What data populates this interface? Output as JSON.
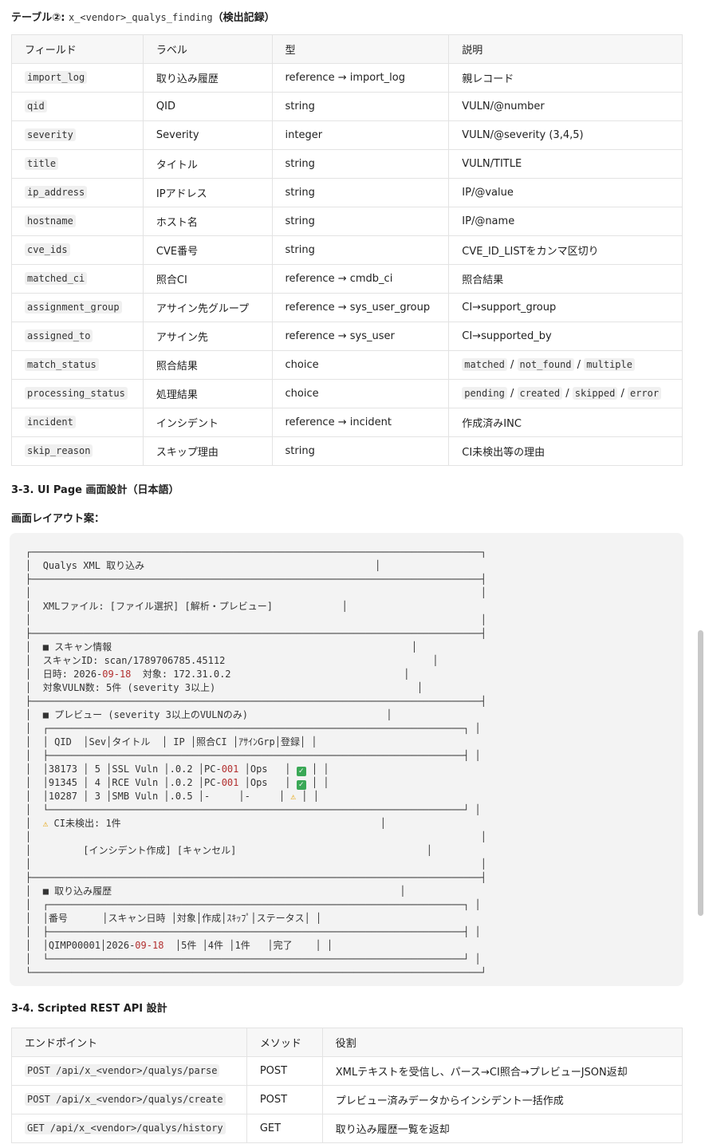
{
  "table2": {
    "title_prefix": "テーブル②: ",
    "table_name": "x_<vendor>_qualys_finding",
    "title_suffix": "（検出記録）",
    "headers": [
      "フィールド",
      "ラベル",
      "型",
      "説明"
    ],
    "rows": [
      {
        "field": "import_log",
        "label": "取り込み履歴",
        "type": "reference → import_log",
        "desc": "親レコード"
      },
      {
        "field": "qid",
        "label": "QID",
        "type": "string",
        "desc": "VULN/@number"
      },
      {
        "field": "severity",
        "label": "Severity",
        "type": "integer",
        "desc": "VULN/@severity (3,4,5)"
      },
      {
        "field": "title",
        "label": "タイトル",
        "type": "string",
        "desc": "VULN/TITLE"
      },
      {
        "field": "ip_address",
        "label": "IPアドレス",
        "type": "string",
        "desc": "IP/@value"
      },
      {
        "field": "hostname",
        "label": "ホスト名",
        "type": "string",
        "desc": "IP/@name"
      },
      {
        "field": "cve_ids",
        "label": "CVE番号",
        "type": "string",
        "desc": "CVE_ID_LISTをカンマ区切り"
      },
      {
        "field": "matched_ci",
        "label": "照合CI",
        "type": "reference → cmdb_ci",
        "desc": "照合結果"
      },
      {
        "field": "assignment_group",
        "label": "アサイン先グループ",
        "type": "reference → sys_user_group",
        "desc": "CI→support_group"
      },
      {
        "field": "assigned_to",
        "label": "アサイン先",
        "type": "reference → sys_user",
        "desc": "CI→supported_by"
      },
      {
        "field": "match_status",
        "label": "照合結果",
        "type": "choice",
        "desc_codes": [
          "matched",
          "not_found",
          "multiple"
        ]
      },
      {
        "field": "processing_status",
        "label": "処理結果",
        "type": "choice",
        "desc_codes": [
          "pending",
          "created",
          "skipped",
          "error"
        ]
      },
      {
        "field": "incident",
        "label": "インシデント",
        "type": "reference → incident",
        "desc": "作成済みINC"
      },
      {
        "field": "skip_reason",
        "label": "スキップ理由",
        "type": "string",
        "desc": "CI未検出等の理由"
      }
    ]
  },
  "section_3_3": {
    "title": "3-3. UI Page 画面設計（日本語）",
    "layout_title": "画面レイアウト案："
  },
  "mockup": {
    "app_title": "Qualys XML 取り込み",
    "xml_line": "XMLファイル: [ファイル選択] [解析・プレビュー]",
    "scan_info_title": "■ スキャン情報",
    "scan_id": "スキャンID: scan/1789706785.45112",
    "datetime_label": "日時: ",
    "datetime_y": "2026-",
    "datetime_md": "09-18",
    "target": "  対象: 172.31.0.2",
    "vuln_count": "対象VULN数: 5件 (severity 3以上)",
    "preview_title": "■ プレビュー (severity 3以上のVULNのみ)",
    "preview_rows": [
      {
        "qid": "38173",
        "sev": "5",
        "title": "SSL Vuln",
        "ip": ".0.2",
        "ci_pre": "PC-",
        "ci_num": "001",
        "grp": "Ops",
        "status": "ok"
      },
      {
        "qid": "91345",
        "sev": "4",
        "title": "RCE Vuln",
        "ip": ".0.2",
        "ci_pre": "PC-",
        "ci_num": "001",
        "grp": "Ops",
        "status": "ok"
      },
      {
        "qid": "10287",
        "sev": "3",
        "title": "SMB Vuln",
        "ip": ".0.5",
        "ci_pre": "",
        "ci_num": "-",
        "grp": "-",
        "status": "warn"
      }
    ],
    "ci_not_found": "CI未検出: 1件",
    "buttons": "[インシデント作成] [キャンセル]",
    "history_title": "■ 取り込み履歴",
    "history_row": {
      "no": "QIMP00001",
      "dt_y": "2026-",
      "dt_md": "09-18",
      "targets": "5件",
      "created": "4件",
      "skipped": "1件",
      "status": "完了"
    }
  },
  "section_3_4": {
    "title": "3-4. Scripted REST API 設計",
    "headers": [
      "エンドポイント",
      "メソッド",
      "役割"
    ],
    "rows": [
      {
        "endpoint": "POST /api/x_<vendor>/qualys/parse",
        "method": "POST",
        "role": "XMLテキストを受信し、パース→CI照合→プレビューJSON返却"
      },
      {
        "endpoint": "POST /api/x_<vendor>/qualys/create",
        "method": "POST",
        "role": "プレビュー済みデータからインシデント一括作成"
      },
      {
        "endpoint": "GET /api/x_<vendor>/qualys/history",
        "method": "GET",
        "role": "取り込み履歴一覧を返却"
      }
    ]
  }
}
